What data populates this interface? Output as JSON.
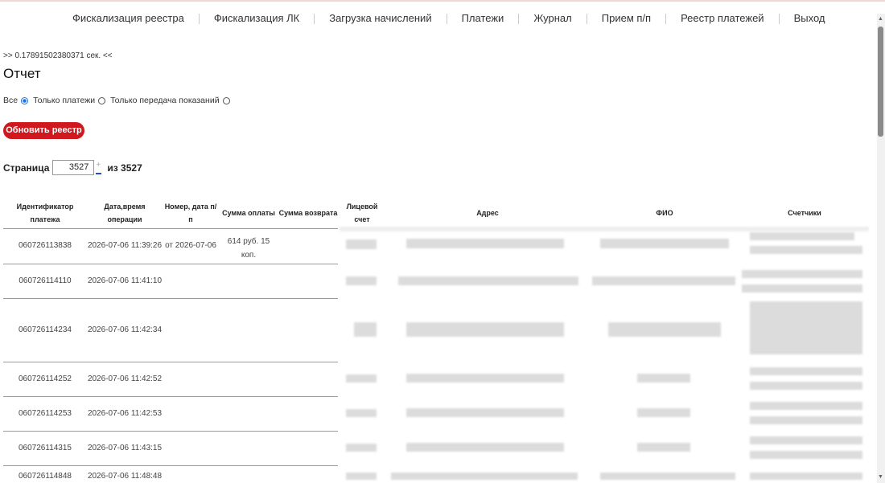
{
  "nav": {
    "items": [
      "Фискализация реестра",
      "Фискализация ЛК",
      "Загрузка начислений",
      "Платежи",
      "Журнал",
      "Прием п/п",
      "Реестр платежей",
      "Выход"
    ]
  },
  "timing": ">> 0.17891502380371 сек. <<",
  "title": "Отчет",
  "filter": {
    "options": [
      "Все",
      "Только платежи",
      "Только передача показаний"
    ],
    "selected": "Все"
  },
  "refresh_button": "Обновить реестр",
  "pager": {
    "label": "Страница",
    "current": "3527",
    "of_label": "из 3527",
    "up": "+",
    "down": "−"
  },
  "table": {
    "headers": [
      "Идентификатор платежа",
      "Дата,время операции",
      "Номер, дата п/п",
      "Сумма оплаты",
      "Сумма возврата",
      "Лицевой счет",
      "Адрес",
      "ФИО",
      "Счетчики"
    ],
    "rows": [
      {
        "id": "060726113838",
        "datetime": "2026-07-06 11:39:26",
        "number": "от 2026-07-06",
        "amount": "614 руб. 15 коп.",
        "refund": ""
      },
      {
        "id": "060726114110",
        "datetime": "2026-07-06 11:41:10",
        "number": "",
        "amount": "",
        "refund": ""
      },
      {
        "id": "060726114234",
        "datetime": "2026-07-06 11:42:34",
        "number": "",
        "amount": "",
        "refund": ""
      },
      {
        "id": "060726114252",
        "datetime": "2026-07-06 11:42:52",
        "number": "",
        "amount": "",
        "refund": ""
      },
      {
        "id": "060726114253",
        "datetime": "2026-07-06 11:42:53",
        "number": "",
        "amount": "",
        "refund": ""
      },
      {
        "id": "060726114315",
        "datetime": "2026-07-06 11:43:15",
        "number": "",
        "amount": "",
        "refund": ""
      },
      {
        "id": "060726114848",
        "datetime": "2026-07-06 11:48:48",
        "number": "",
        "amount": "",
        "refund": ""
      }
    ]
  },
  "colors": {
    "accent": "#d0191f",
    "radio": "#1a73e8"
  }
}
